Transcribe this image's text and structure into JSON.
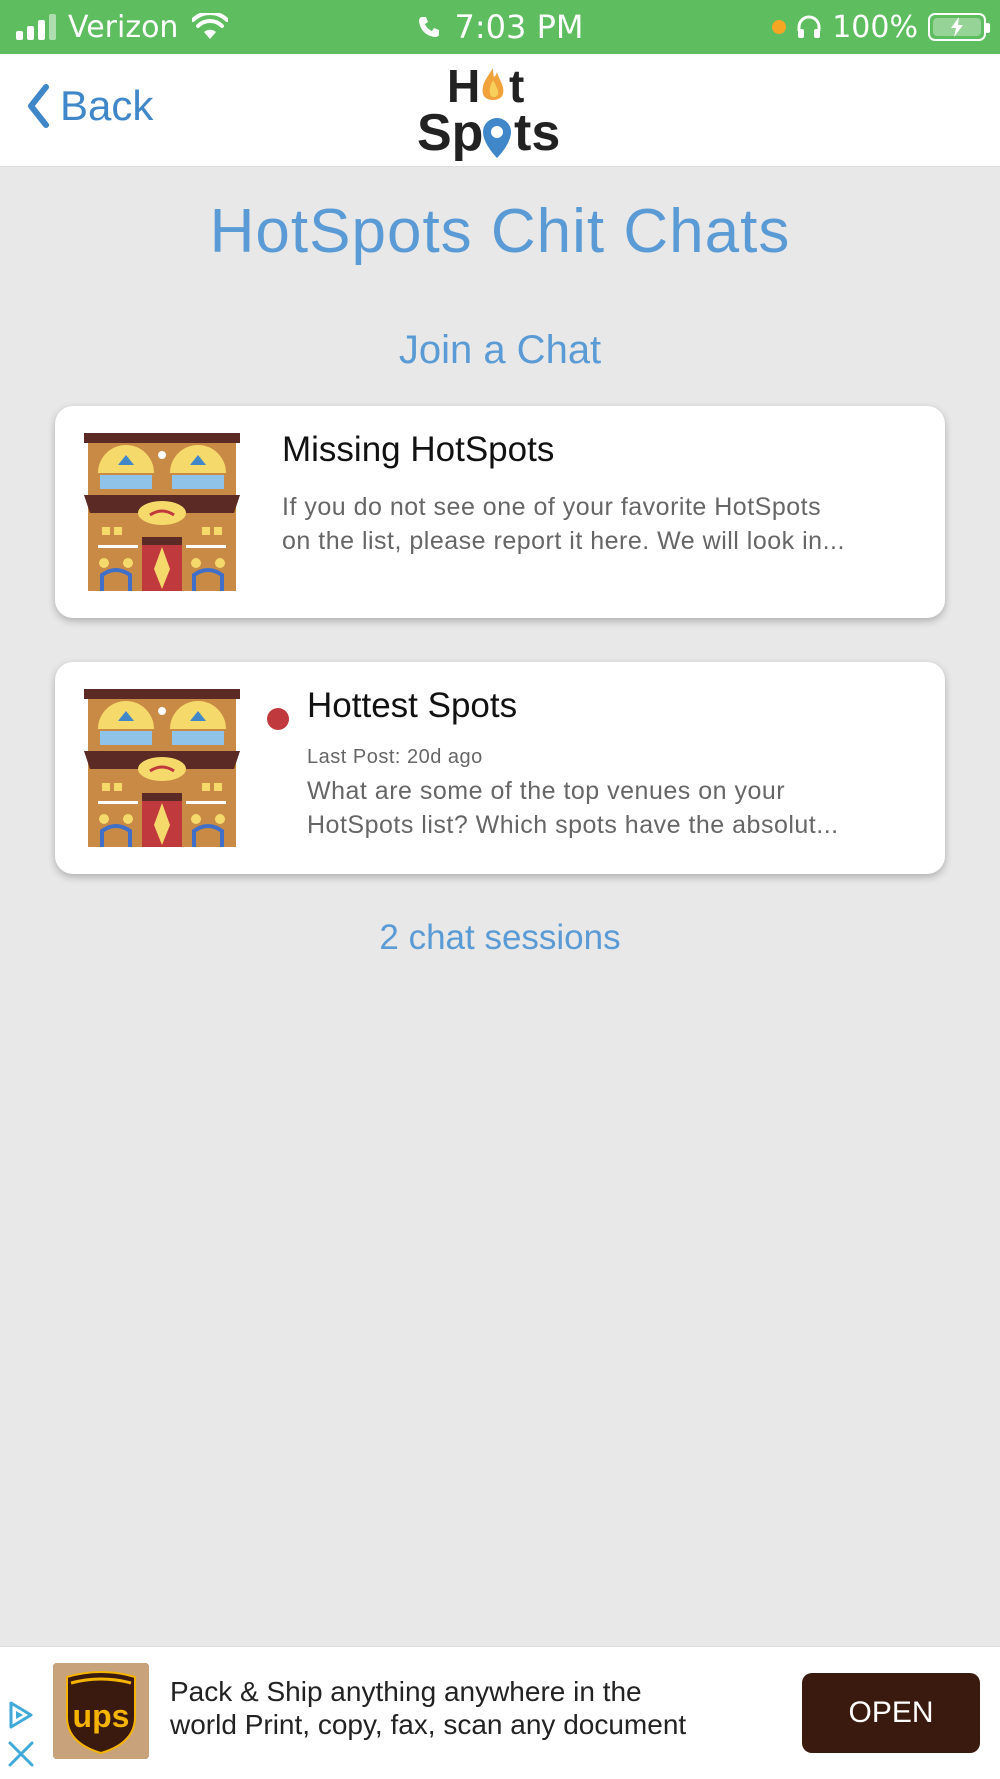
{
  "status_bar": {
    "carrier": "Verizon",
    "time": "7:03 PM",
    "battery": "100%"
  },
  "nav": {
    "back_label": "Back",
    "logo_text_top": "Hot",
    "logo_text_bottom": "Spots"
  },
  "page": {
    "title": "HotSpots Chit Chats",
    "section_heading": "Join a Chat",
    "session_count": "2 chat sessions"
  },
  "chats": [
    {
      "title": "Missing HotSpots",
      "description_line1": "If you do not see one of your favorite HotSpots",
      "description_line2": "on the list, please report it here. We will look in...",
      "unread": false
    },
    {
      "title": "Hottest Spots",
      "last_post": "Last Post: 20d ago",
      "description_line1": "What are some of the top venues on your",
      "description_line2": "HotSpots list? Which spots have the absolut...",
      "unread": true
    }
  ],
  "ad": {
    "text_line1": "Pack & Ship anything anywhere in the",
    "text_line2": "world Print, copy, fax, scan any document",
    "open_label": "OPEN",
    "brand": "ups"
  },
  "colors": {
    "status_green": "#5dbd5f",
    "accent_blue": "#5b9bd5",
    "link_blue": "#3f87c9",
    "unread_red": "#c0393d",
    "ups_brown": "#3a1a0e"
  }
}
